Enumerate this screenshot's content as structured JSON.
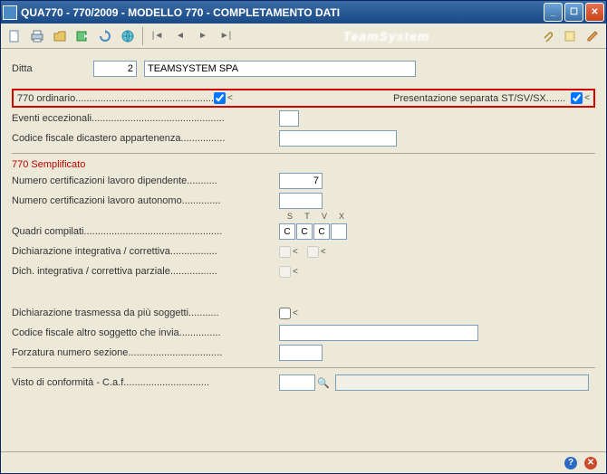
{
  "window": {
    "title": "QUA770  - 770/2009  -  MODELLO 770 - COMPLETAMENTO DATI"
  },
  "brand": "TeamSystem",
  "ditta": {
    "label": "Ditta",
    "code": "2",
    "name": "TEAMSYSTEM SPA"
  },
  "ordinario": {
    "label": "770 ordinario..................................................",
    "checked": true,
    "pres_label": "Presentazione separata ST/SV/SX.......",
    "pres_checked": true
  },
  "eventi": {
    "label": "Eventi eccezionali................................................",
    "value": ""
  },
  "codfisc_dicastero": {
    "label": "Codice fiscale dicastero appartenenza................",
    "value": ""
  },
  "semplificato": {
    "title": "770 Semplificato",
    "cert_dip": {
      "label": "Numero certificazioni lavoro dipendente...........",
      "value": "7"
    },
    "cert_aut": {
      "label": "Numero certificazioni lavoro autonomo..............",
      "value": ""
    },
    "quadri": {
      "label": "Quadri compilati..................................................",
      "cols": [
        "S",
        "T",
        "V",
        "X"
      ],
      "vals": [
        "C",
        "C",
        "C",
        ""
      ]
    },
    "dich_int": {
      "label": "Dichiarazione integrativa / correttiva.................",
      "checked": false
    },
    "dich_int_parz": {
      "label": "Dich. integrativa / correttiva parziale.................",
      "checked": false
    }
  },
  "trasmessa": {
    "label": "Dichiarazione trasmessa da più soggetti...........",
    "checked": false
  },
  "codfisc_altro": {
    "label": "Codice fiscale altro soggetto che invia...............",
    "value": ""
  },
  "forzatura": {
    "label": "Forzatura numero sezione..................................",
    "value": ""
  },
  "visto": {
    "label": "Visto di conformità - C.a.f...............................",
    "code": "",
    "desc": ""
  }
}
